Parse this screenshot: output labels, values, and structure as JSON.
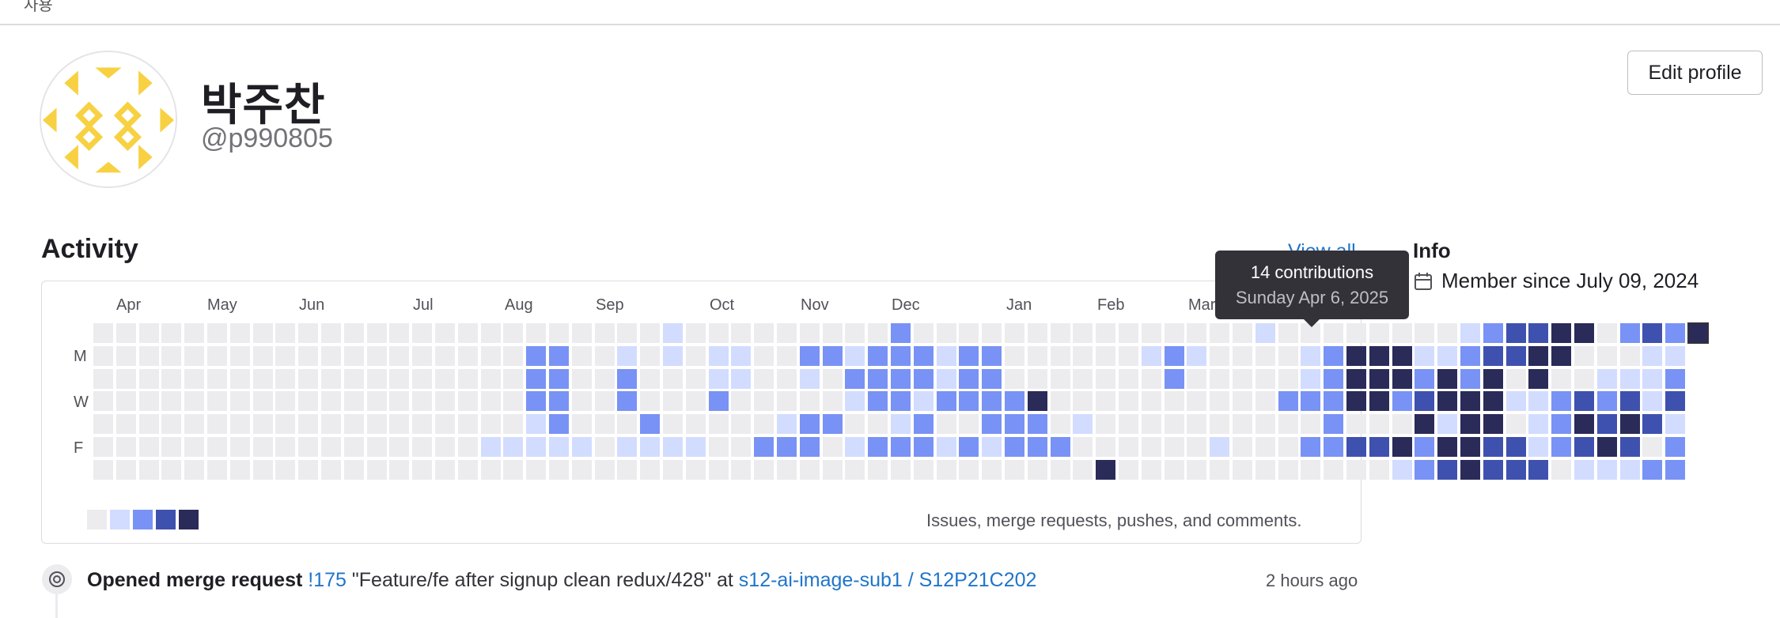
{
  "header": {
    "breadcrumb": "사용"
  },
  "profile": {
    "name": "박주찬",
    "handle": "@p990805",
    "edit_label": "Edit profile"
  },
  "activity": {
    "title": "Activity",
    "view_all": "View all",
    "months": [
      "Apr",
      "May",
      "Jun",
      "Jul",
      "Aug",
      "Sep",
      "Oct",
      "Nov",
      "Dec",
      "Jan",
      "Feb",
      "Mar"
    ],
    "day_labels": [
      "M",
      "W",
      "F"
    ],
    "legend_note": "Issues, merge requests, pushes, and comments.",
    "tooltip": {
      "count": "14 contributions",
      "date": "Sunday Apr 6, 2025"
    },
    "levels": [
      "#ececef",
      "#d2dcff",
      "#7992f5",
      "#3f51ae",
      "#2a2b59"
    ],
    "grid_rows": [
      "00000000000000000000000001000000000200000000000000010000000012334402324",
      "00000000000000000002200101011002212221220000001210000124441123344000112",
      "00000000000000000002200200011001022221220000000200000124442424040011122",
      "00000000000000000002200200020000012212222400000000002224423444112323132",
      "00000000000000000001200020000012200120022201000000000020004144012434314",
      "00000000000000000111110111100222012221212220000001000223342443312343022",
      "00000000000000000000000000000000000000000000400000000000012343330111223"
    ]
  },
  "info": {
    "title": "Info",
    "member_since": "Member since July 09, 2024",
    "calendar_icon": "calendar-icon"
  },
  "event": {
    "verb": "Opened merge request",
    "mr_ref": "!175",
    "mr_title": "\"Feature/fe after signup clean redux/428\"",
    "at": "at",
    "project": "s12-ai-image-sub1 / S12P21C202",
    "time": "2 hours ago"
  }
}
